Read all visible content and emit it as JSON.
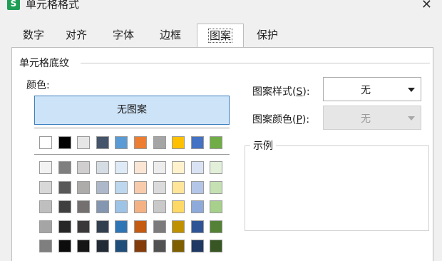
{
  "window": {
    "title": "单元格格式",
    "app_icon_glyph": "S",
    "close_glyph": "✕"
  },
  "tabs": [
    {
      "label": "数字",
      "active": false
    },
    {
      "label": "对齐",
      "active": false
    },
    {
      "label": "字体",
      "active": false
    },
    {
      "label": "边框",
      "active": false
    },
    {
      "label": "图案",
      "active": true
    },
    {
      "label": "保护",
      "active": false
    }
  ],
  "shading": {
    "group_label": "单元格底纹",
    "color_label": "颜色:",
    "no_pattern_button": "无图案",
    "theme_colors": [
      "#ffffff",
      "#000000",
      "#e7e6e6",
      "#44546a",
      "#5b9bd5",
      "#ed7d31",
      "#a5a5a5",
      "#ffc000",
      "#4472c4",
      "#70ad47"
    ],
    "shade_rows": [
      [
        "#f2f2f2",
        "#7f7f7f",
        "#d0cece",
        "#d6dce4",
        "#deebf6",
        "#fbe5d5",
        "#ededed",
        "#fff2cc",
        "#dae3f3",
        "#e2efd9"
      ],
      [
        "#d8d8d8",
        "#595959",
        "#aeabab",
        "#adb9ca",
        "#bdd7ee",
        "#f7cbac",
        "#dbdbdb",
        "#fee599",
        "#b4c6e7",
        "#c5e0b3"
      ],
      [
        "#bfbfbf",
        "#3f3f3f",
        "#757070",
        "#8496b0",
        "#9dc3e6",
        "#f4b183",
        "#c9c9c9",
        "#ffd965",
        "#8eaadb",
        "#a8d08d"
      ],
      [
        "#a5a5a5",
        "#262626",
        "#3a3838",
        "#323f4f",
        "#2e75b5",
        "#c55a11",
        "#7b7b7b",
        "#bf9000",
        "#2f5496",
        "#538135"
      ],
      [
        "#7f7f7f",
        "#0c0c0c",
        "#171616",
        "#222a35",
        "#1e4e79",
        "#843c0b",
        "#525252",
        "#7f6000",
        "#1f3864",
        "#375623"
      ]
    ]
  },
  "pattern_style": {
    "label": "图案样式(",
    "key": "S",
    "suffix": "):",
    "value": "无"
  },
  "pattern_color": {
    "label": "图案颜色(",
    "key": "P",
    "suffix": "):",
    "value": "无"
  },
  "sample": {
    "label": "示例"
  }
}
